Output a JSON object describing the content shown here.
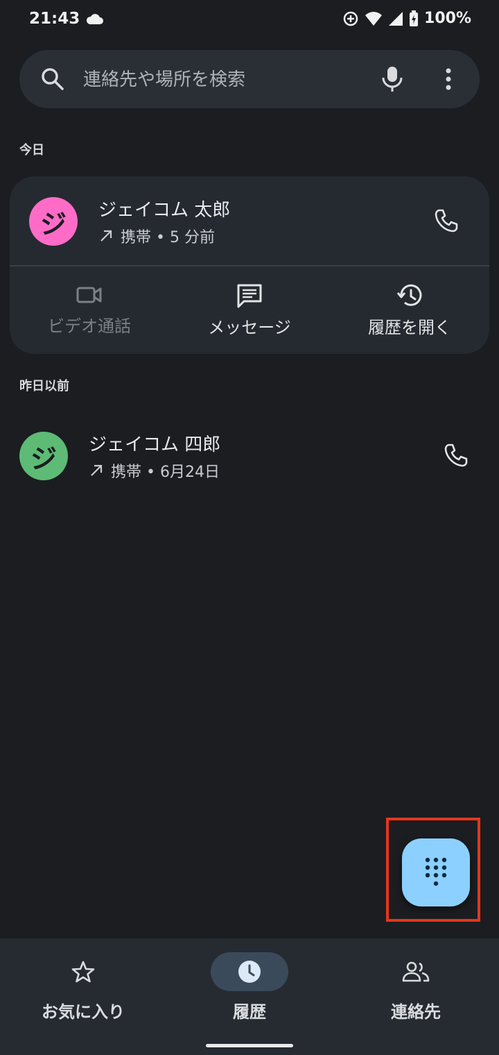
{
  "status_bar": {
    "time": "21:43",
    "battery": "100%"
  },
  "search": {
    "placeholder": "連絡先や場所を検索"
  },
  "sections": {
    "today": "今日",
    "earlier": "昨日以前"
  },
  "calls": [
    {
      "initial": "ジ",
      "name": "ジェイコム 太郎",
      "detail": "携帯 • 5 分前",
      "avatar_color": "#ff6cc8"
    },
    {
      "initial": "ジ",
      "name": "ジェイコム 四郎",
      "detail": "携帯 • 6月24日",
      "avatar_color": "#5dbb75"
    }
  ],
  "card_actions": {
    "video": "ビデオ通話",
    "message": "メッセージ",
    "history": "履歴を開く"
  },
  "bottom_nav": {
    "favorites": "お気に入り",
    "recents": "履歴",
    "contacts": "連絡先"
  },
  "colors": {
    "accent": "#8cd0ff",
    "highlight": "#e5361b"
  },
  "icons": [
    "search-icon",
    "mic-icon",
    "more-vert-icon",
    "phone-icon",
    "video-icon",
    "message-icon",
    "history-icon",
    "dialpad-icon",
    "star-icon",
    "clock-icon",
    "people-icon"
  ]
}
